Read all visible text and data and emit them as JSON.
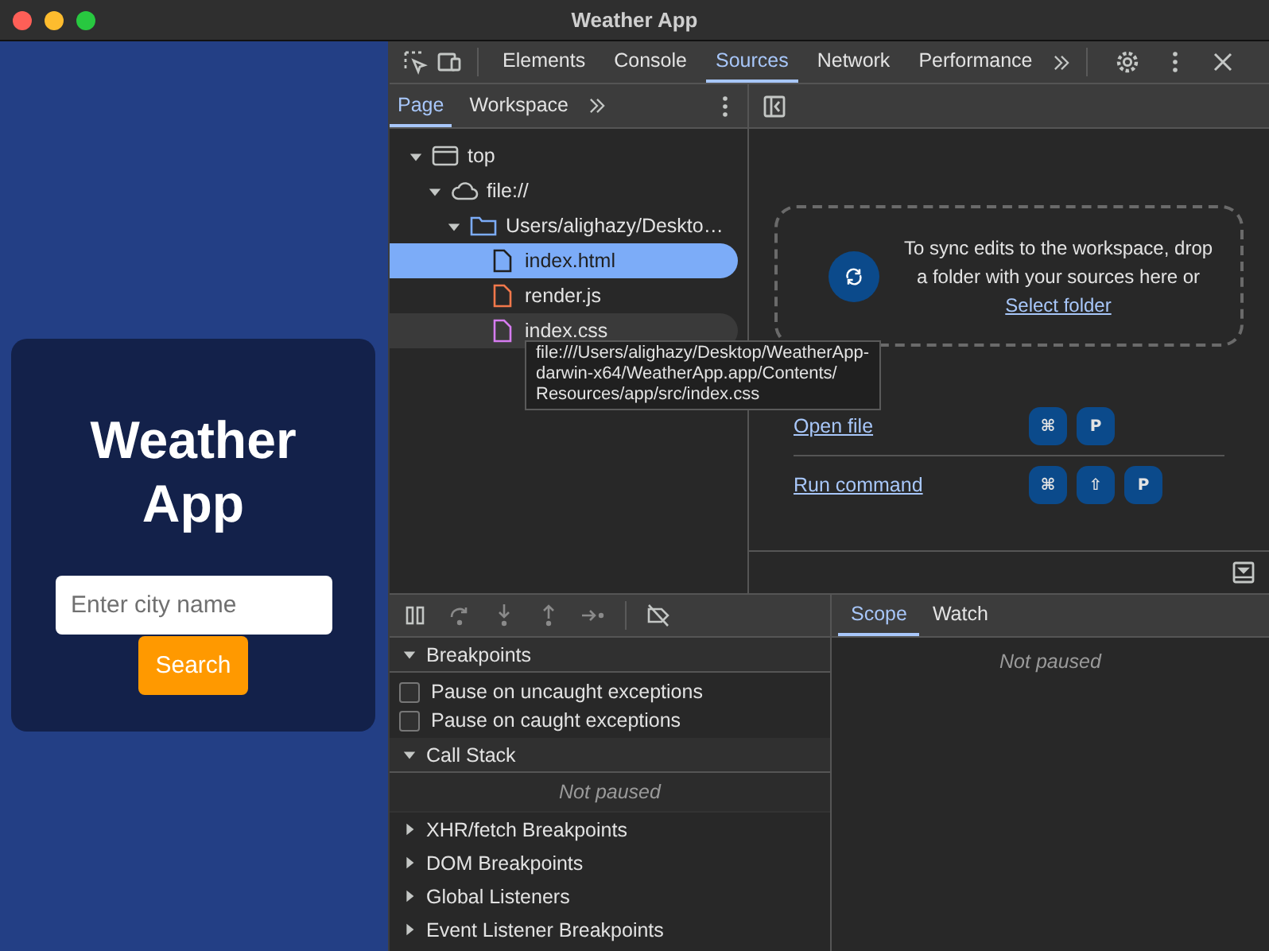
{
  "window": {
    "title": "Weather App"
  },
  "app": {
    "title": "Weather App",
    "city_input": {
      "placeholder": "Enter city name"
    },
    "search_button": "Search"
  },
  "devtools": {
    "tabs": [
      {
        "label": "Elements",
        "selected": false
      },
      {
        "label": "Console",
        "selected": false
      },
      {
        "label": "Sources",
        "selected": true
      },
      {
        "label": "Network",
        "selected": false
      },
      {
        "label": "Performance",
        "selected": false
      }
    ],
    "navigator": {
      "tabs": [
        {
          "label": "Page",
          "selected": true
        },
        {
          "label": "Workspace",
          "selected": false
        }
      ],
      "tree": [
        {
          "label": "top",
          "kind": "frame",
          "expanded": true,
          "children": [
            {
              "label": "file://",
              "kind": "cloud",
              "expanded": true,
              "children": [
                {
                  "label": "Users/alighazy/Deskto…",
                  "kind": "folder",
                  "expanded": true,
                  "children": [
                    {
                      "label": "index.html",
                      "kind": "html",
                      "selected": true,
                      "hovered": false
                    },
                    {
                      "label": "render.js",
                      "kind": "js",
                      "selected": false,
                      "hovered": false
                    },
                    {
                      "label": "index.css",
                      "kind": "css",
                      "selected": false,
                      "hovered": true
                    }
                  ]
                }
              ]
            }
          ]
        }
      ],
      "tooltip_lines": [
        "file:///Users/alighazy/Desktop/WeatherApp-",
        "darwin-x64/WeatherApp.app/Contents/",
        "Resources/app/src/index.css"
      ]
    }
  },
  "editor": {
    "message": "To sync edits to the workspace, drop a folder with your sources here or",
    "link": "Select folder",
    "shortcuts": [
      {
        "label": "Open file",
        "keys": [
          "⌘",
          "P"
        ]
      },
      {
        "label": "Run command",
        "keys": [
          "⌘",
          "⇧",
          "P"
        ]
      }
    ]
  },
  "debugger": {
    "sections": [
      {
        "title": "Breakpoints",
        "expanded": true,
        "kind": "checkboxes",
        "items": [
          {
            "label": "Pause on uncaught exceptions",
            "checked": false
          },
          {
            "label": "Pause on caught exceptions",
            "checked": false
          }
        ]
      },
      {
        "title": "Call Stack",
        "expanded": true,
        "kind": "message",
        "message": "Not paused"
      },
      {
        "title": "XHR/fetch Breakpoints",
        "expanded": false
      },
      {
        "title": "DOM Breakpoints",
        "expanded": false
      },
      {
        "title": "Global Listeners",
        "expanded": false
      },
      {
        "title": "Event Listener Breakpoints",
        "expanded": false
      }
    ]
  },
  "sidebar": {
    "tabs": [
      {
        "label": "Scope",
        "selected": true
      },
      {
        "label": "Watch",
        "selected": false
      }
    ],
    "message": "Not paused"
  }
}
